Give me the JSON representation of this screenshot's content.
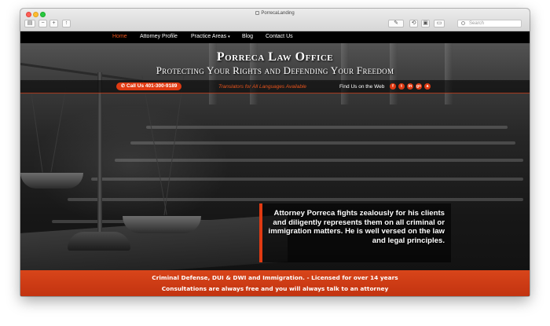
{
  "browser": {
    "tab_title": "PorrecaLanding",
    "search_placeholder": "Search"
  },
  "nav": {
    "items": [
      {
        "label": "Home",
        "active": true
      },
      {
        "label": "Attorney Profile",
        "active": false
      },
      {
        "label": "Practice Areas",
        "active": false,
        "has_dropdown": true
      },
      {
        "label": "Blog",
        "active": false
      },
      {
        "label": "Contact Us",
        "active": false
      }
    ],
    "caret": "▾"
  },
  "header": {
    "title": "Porreca Law Office",
    "tagline": "Protecting Your Rights and Defending Your Freedom"
  },
  "contact_bar": {
    "call_label": "Call Us 401-300-9189",
    "phone_icon": "phone-icon",
    "translators": "Translators for All Languages Available",
    "find_us": "Find Us on the Web",
    "social_icons": [
      {
        "name": "facebook-icon",
        "glyph": "f"
      },
      {
        "name": "twitter-icon",
        "glyph": "t"
      },
      {
        "name": "linkedin-icon",
        "glyph": "in"
      },
      {
        "name": "google-plus-icon",
        "glyph": "g+"
      },
      {
        "name": "avvo-icon",
        "glyph": "a"
      }
    ]
  },
  "quote": {
    "text": "Attorney Porreca fights zealously for his clients and diligently represents them on all criminal or immigration matters. He is well versed on the law and legal principles."
  },
  "footer": {
    "line1": "Criminal Defense, DUI & DWI and Immigration. - Licensed for over 14 years",
    "line2": "Consultations are always free and you will always talk to an attorney"
  },
  "colors": {
    "accent": "#e03a12",
    "nav_active": "#e8531c",
    "band": "#d04018"
  }
}
